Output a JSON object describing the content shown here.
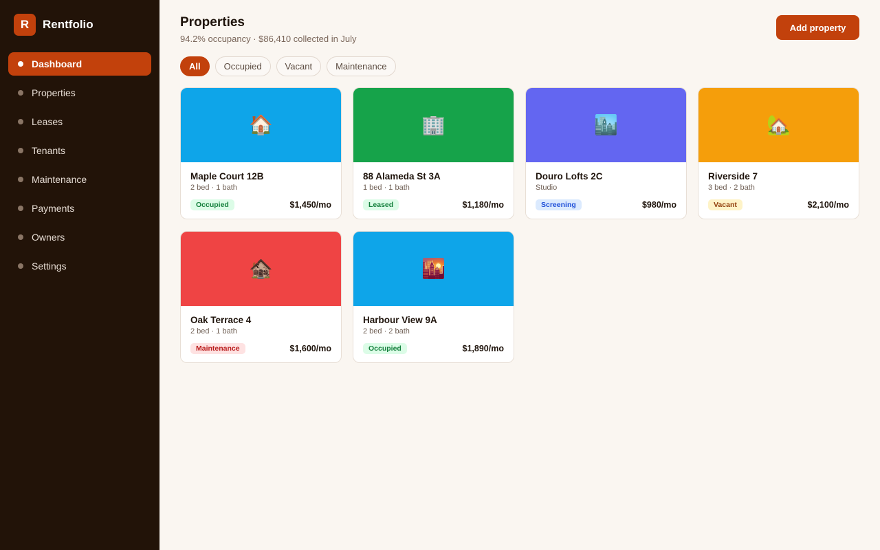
{
  "app": {
    "logo_letter": "R",
    "name": "Rentfolio"
  },
  "sidebar": {
    "items": [
      {
        "label": "Dashboard",
        "active": true
      },
      {
        "label": "Properties",
        "active": false
      },
      {
        "label": "Leases",
        "active": false
      },
      {
        "label": "Tenants",
        "active": false
      },
      {
        "label": "Maintenance",
        "active": false
      },
      {
        "label": "Payments",
        "active": false
      },
      {
        "label": "Owners",
        "active": false
      },
      {
        "label": "Settings",
        "active": false
      }
    ]
  },
  "header": {
    "title": "Properties",
    "subtitle": "94.2% occupancy · $86,410 collected in July",
    "add_button": "Add property"
  },
  "filters": [
    {
      "label": "All",
      "active": true
    },
    {
      "label": "Occupied",
      "active": false
    },
    {
      "label": "Vacant",
      "active": false
    },
    {
      "label": "Maintenance",
      "active": false
    }
  ],
  "properties": [
    {
      "name": "Maple Court 12B",
      "meta": "2 bed · 1 bath",
      "status": "Occupied",
      "status_key": "occupied",
      "rent": "$1,450/mo",
      "color": "#0ea5e9",
      "icon": "🏠",
      "icon_name": "house-icon"
    },
    {
      "name": "88 Alameda St 3A",
      "meta": "1 bed · 1 bath",
      "status": "Leased",
      "status_key": "leased",
      "rent": "$1,180/mo",
      "color": "#16a34a",
      "icon": "🏢",
      "icon_name": "office-building-icon"
    },
    {
      "name": "Douro Lofts 2C",
      "meta": "Studio",
      "status": "Screening",
      "status_key": "screening",
      "rent": "$980/mo",
      "color": "#6366f1",
      "icon": "🏙️",
      "icon_name": "cityscape-icon"
    },
    {
      "name": "Riverside 7",
      "meta": "3 bed · 2 bath",
      "status": "Vacant",
      "status_key": "vacant",
      "rent": "$2,100/mo",
      "color": "#f59e0b",
      "icon": "🏡",
      "icon_name": "house-with-garden-icon"
    },
    {
      "name": "Oak Terrace 4",
      "meta": "2 bed · 1 bath",
      "status": "Maintenance",
      "status_key": "maintenance",
      "rent": "$1,600/mo",
      "color": "#ef4444",
      "icon": "🏚️",
      "icon_name": "derelict-house-icon"
    },
    {
      "name": "Harbour View 9A",
      "meta": "2 bed · 2 bath",
      "status": "Occupied",
      "status_key": "occupied",
      "rent": "$1,890/mo",
      "color": "#0ea5e9",
      "icon": "🌇",
      "icon_name": "sunset-city-icon"
    }
  ]
}
